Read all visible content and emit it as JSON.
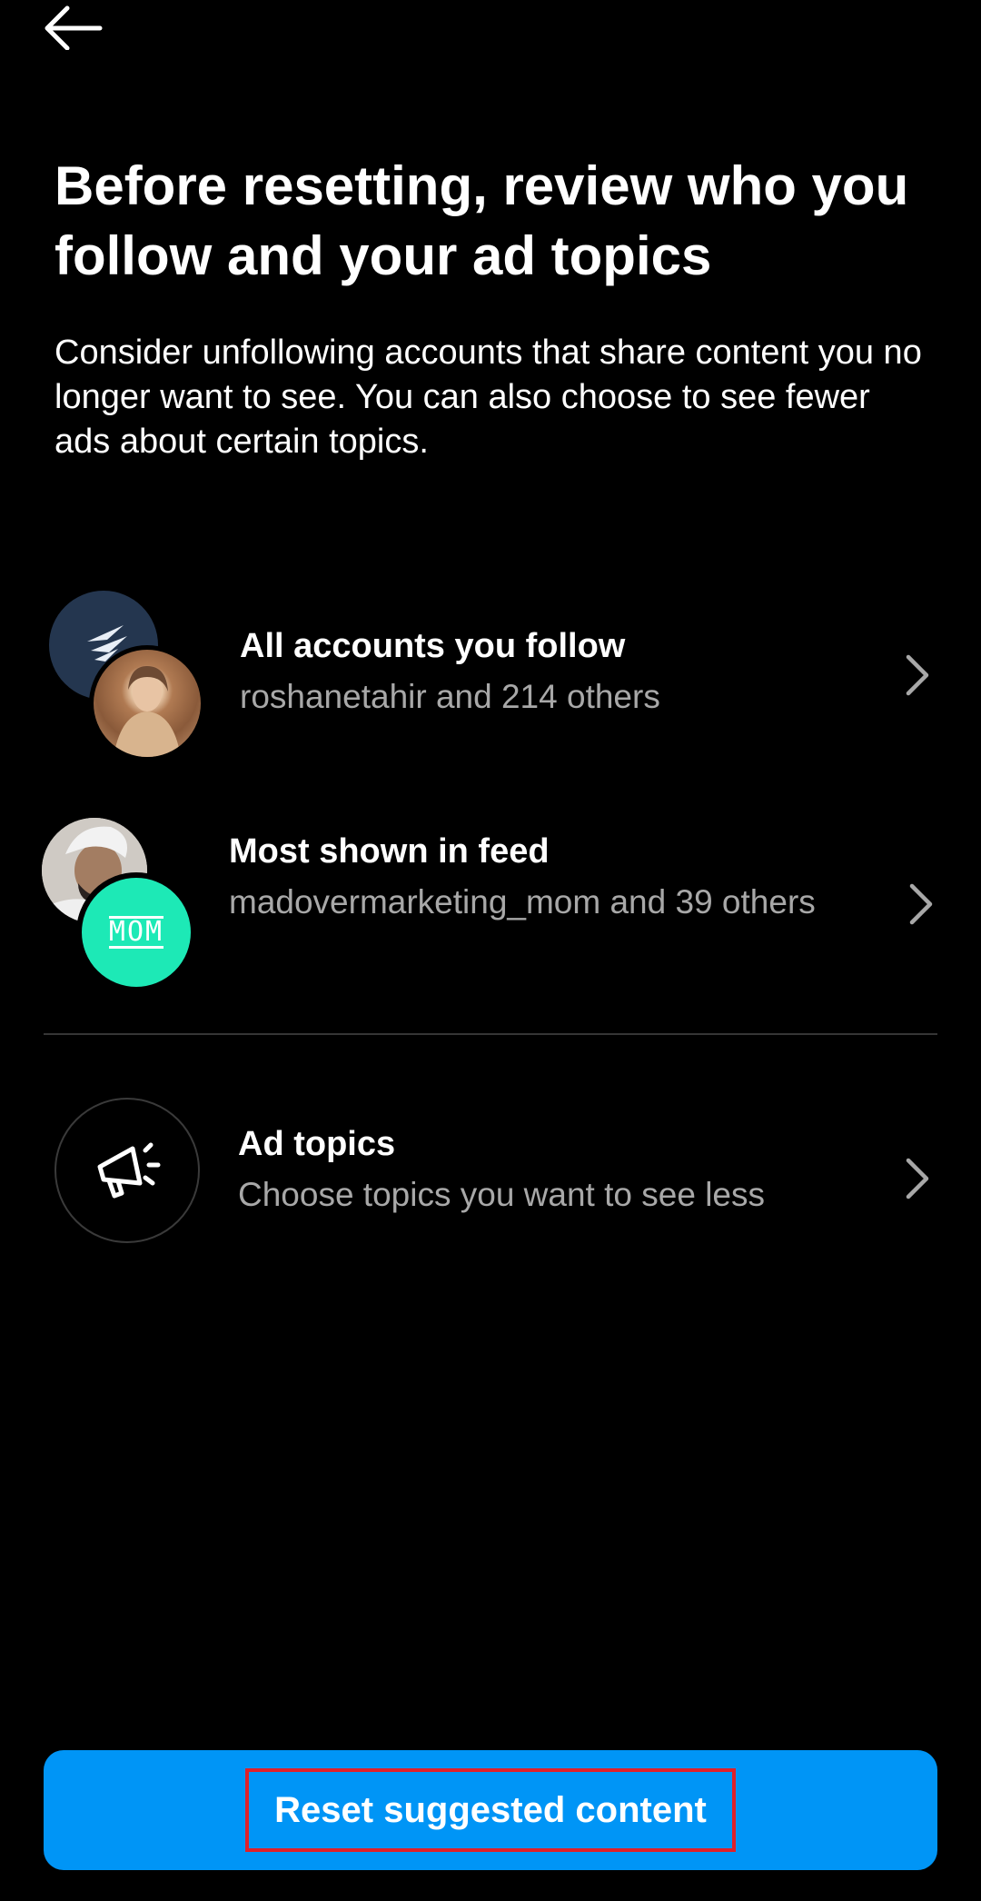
{
  "header": {
    "back_icon": "arrow-left-icon"
  },
  "page": {
    "title": "Before resetting, review who you follow and your ad topics",
    "description": "Consider unfollowing accounts that share content you no longer want to see. You can also choose to see fewer ads about certain topics."
  },
  "rows": [
    {
      "title": "All accounts you follow",
      "subtitle": "roshanetahir and 214 others",
      "icon": "chevron-right-icon"
    },
    {
      "title": "Most shown in feed",
      "subtitle": "madovermarketing_mom and 39 others",
      "icon": "chevron-right-icon",
      "avatar_text": "MOM"
    },
    {
      "title": "Ad topics",
      "subtitle": "Choose topics you want to see less",
      "icon": "megaphone-icon"
    }
  ],
  "footer": {
    "reset_label": "Reset suggested content"
  },
  "colors": {
    "background": "#000000",
    "primary_button": "#0095f6",
    "secondary_text": "#a8a8a8",
    "highlight_border": "#e0202a",
    "mom_avatar": "#1de9b6"
  }
}
